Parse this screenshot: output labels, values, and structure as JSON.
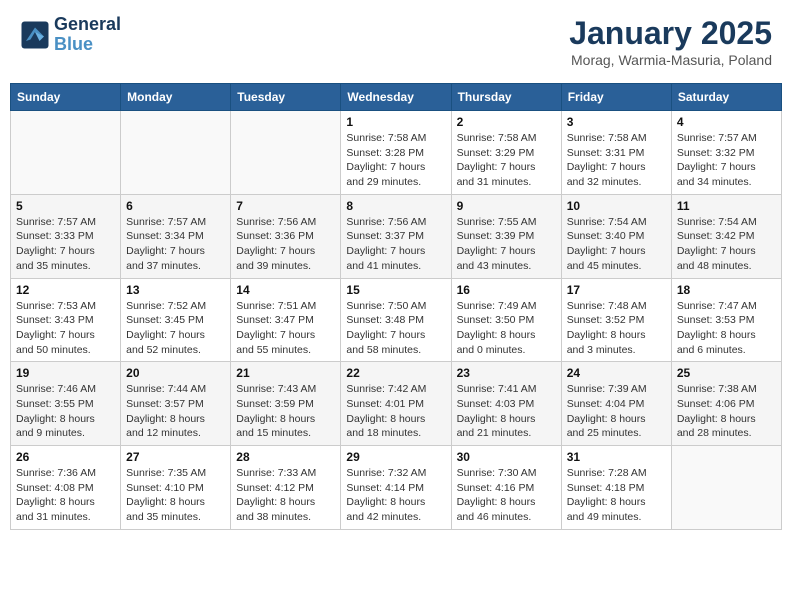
{
  "header": {
    "logo_line1": "General",
    "logo_line2": "Blue",
    "month": "January 2025",
    "location": "Morag, Warmia-Masuria, Poland"
  },
  "weekdays": [
    "Sunday",
    "Monday",
    "Tuesday",
    "Wednesday",
    "Thursday",
    "Friday",
    "Saturday"
  ],
  "weeks": [
    [
      {
        "day": "",
        "info": ""
      },
      {
        "day": "",
        "info": ""
      },
      {
        "day": "",
        "info": ""
      },
      {
        "day": "1",
        "info": "Sunrise: 7:58 AM\nSunset: 3:28 PM\nDaylight: 7 hours and 29 minutes."
      },
      {
        "day": "2",
        "info": "Sunrise: 7:58 AM\nSunset: 3:29 PM\nDaylight: 7 hours and 31 minutes."
      },
      {
        "day": "3",
        "info": "Sunrise: 7:58 AM\nSunset: 3:31 PM\nDaylight: 7 hours and 32 minutes."
      },
      {
        "day": "4",
        "info": "Sunrise: 7:57 AM\nSunset: 3:32 PM\nDaylight: 7 hours and 34 minutes."
      }
    ],
    [
      {
        "day": "5",
        "info": "Sunrise: 7:57 AM\nSunset: 3:33 PM\nDaylight: 7 hours and 35 minutes."
      },
      {
        "day": "6",
        "info": "Sunrise: 7:57 AM\nSunset: 3:34 PM\nDaylight: 7 hours and 37 minutes."
      },
      {
        "day": "7",
        "info": "Sunrise: 7:56 AM\nSunset: 3:36 PM\nDaylight: 7 hours and 39 minutes."
      },
      {
        "day": "8",
        "info": "Sunrise: 7:56 AM\nSunset: 3:37 PM\nDaylight: 7 hours and 41 minutes."
      },
      {
        "day": "9",
        "info": "Sunrise: 7:55 AM\nSunset: 3:39 PM\nDaylight: 7 hours and 43 minutes."
      },
      {
        "day": "10",
        "info": "Sunrise: 7:54 AM\nSunset: 3:40 PM\nDaylight: 7 hours and 45 minutes."
      },
      {
        "day": "11",
        "info": "Sunrise: 7:54 AM\nSunset: 3:42 PM\nDaylight: 7 hours and 48 minutes."
      }
    ],
    [
      {
        "day": "12",
        "info": "Sunrise: 7:53 AM\nSunset: 3:43 PM\nDaylight: 7 hours and 50 minutes."
      },
      {
        "day": "13",
        "info": "Sunrise: 7:52 AM\nSunset: 3:45 PM\nDaylight: 7 hours and 52 minutes."
      },
      {
        "day": "14",
        "info": "Sunrise: 7:51 AM\nSunset: 3:47 PM\nDaylight: 7 hours and 55 minutes."
      },
      {
        "day": "15",
        "info": "Sunrise: 7:50 AM\nSunset: 3:48 PM\nDaylight: 7 hours and 58 minutes."
      },
      {
        "day": "16",
        "info": "Sunrise: 7:49 AM\nSunset: 3:50 PM\nDaylight: 8 hours and 0 minutes."
      },
      {
        "day": "17",
        "info": "Sunrise: 7:48 AM\nSunset: 3:52 PM\nDaylight: 8 hours and 3 minutes."
      },
      {
        "day": "18",
        "info": "Sunrise: 7:47 AM\nSunset: 3:53 PM\nDaylight: 8 hours and 6 minutes."
      }
    ],
    [
      {
        "day": "19",
        "info": "Sunrise: 7:46 AM\nSunset: 3:55 PM\nDaylight: 8 hours and 9 minutes."
      },
      {
        "day": "20",
        "info": "Sunrise: 7:44 AM\nSunset: 3:57 PM\nDaylight: 8 hours and 12 minutes."
      },
      {
        "day": "21",
        "info": "Sunrise: 7:43 AM\nSunset: 3:59 PM\nDaylight: 8 hours and 15 minutes."
      },
      {
        "day": "22",
        "info": "Sunrise: 7:42 AM\nSunset: 4:01 PM\nDaylight: 8 hours and 18 minutes."
      },
      {
        "day": "23",
        "info": "Sunrise: 7:41 AM\nSunset: 4:03 PM\nDaylight: 8 hours and 21 minutes."
      },
      {
        "day": "24",
        "info": "Sunrise: 7:39 AM\nSunset: 4:04 PM\nDaylight: 8 hours and 25 minutes."
      },
      {
        "day": "25",
        "info": "Sunrise: 7:38 AM\nSunset: 4:06 PM\nDaylight: 8 hours and 28 minutes."
      }
    ],
    [
      {
        "day": "26",
        "info": "Sunrise: 7:36 AM\nSunset: 4:08 PM\nDaylight: 8 hours and 31 minutes."
      },
      {
        "day": "27",
        "info": "Sunrise: 7:35 AM\nSunset: 4:10 PM\nDaylight: 8 hours and 35 minutes."
      },
      {
        "day": "28",
        "info": "Sunrise: 7:33 AM\nSunset: 4:12 PM\nDaylight: 8 hours and 38 minutes."
      },
      {
        "day": "29",
        "info": "Sunrise: 7:32 AM\nSunset: 4:14 PM\nDaylight: 8 hours and 42 minutes."
      },
      {
        "day": "30",
        "info": "Sunrise: 7:30 AM\nSunset: 4:16 PM\nDaylight: 8 hours and 46 minutes."
      },
      {
        "day": "31",
        "info": "Sunrise: 7:28 AM\nSunset: 4:18 PM\nDaylight: 8 hours and 49 minutes."
      },
      {
        "day": "",
        "info": ""
      }
    ]
  ]
}
